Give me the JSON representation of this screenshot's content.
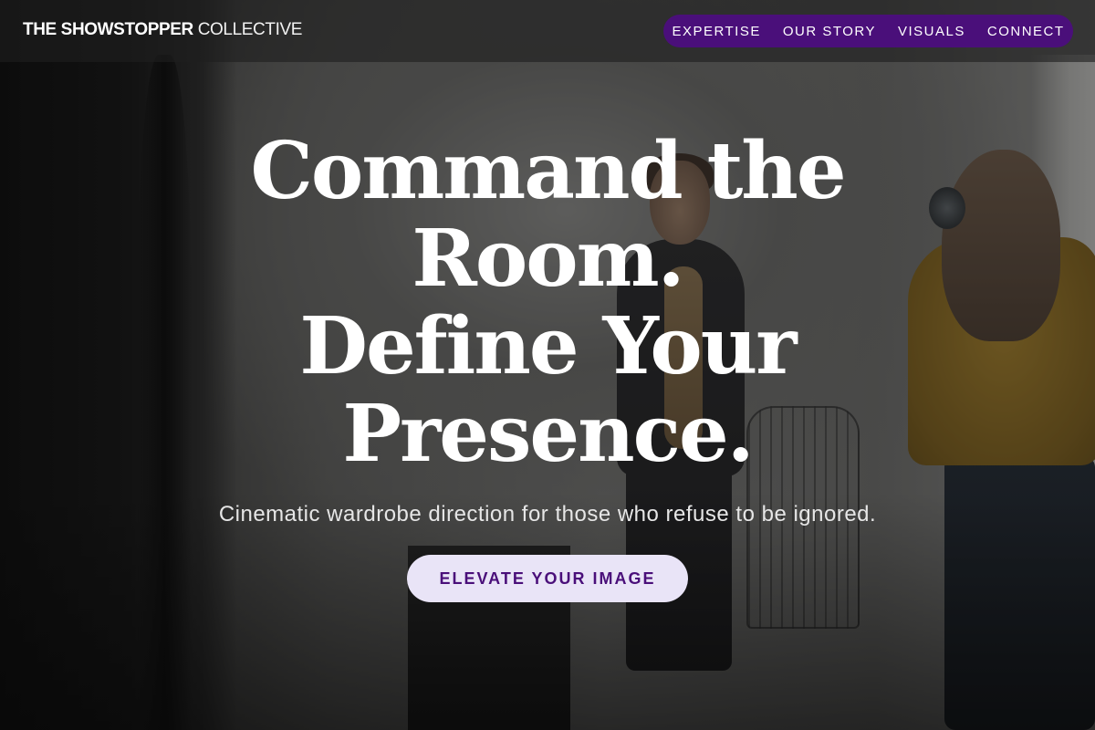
{
  "brand": {
    "name_strong": "THE SHOWSTOPPER",
    "name_light": "COLLECTIVE"
  },
  "nav": {
    "items": [
      {
        "label": "EXPERTISE"
      },
      {
        "label": "OUR STORY"
      },
      {
        "label": "VISUALS"
      },
      {
        "label": "CONNECT"
      }
    ]
  },
  "hero": {
    "headline_lines": [
      "Command the",
      "Room.",
      "Define Your",
      "Presence."
    ],
    "subheading": "Cinematic wardrobe direction for those who refuse to be ignored.",
    "cta_label": "ELEVATE YOUR IMAGE"
  },
  "colors": {
    "nav_background": "#4a0f7a",
    "cta_background": "#e9e4f7",
    "cta_text": "#4a0f7a",
    "text_primary": "#ffffff"
  }
}
